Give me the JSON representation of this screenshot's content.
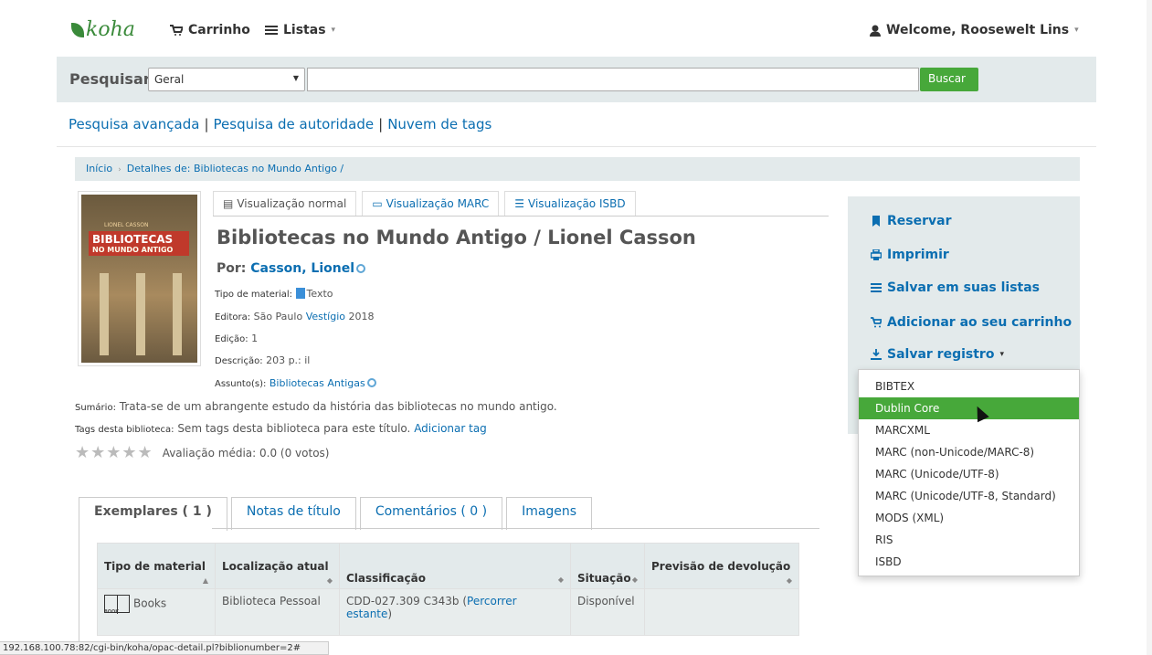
{
  "nav": {
    "logo": "koha",
    "cart": "Carrinho",
    "lists": "Listas",
    "welcome": "Welcome, Roosewelt Lins"
  },
  "search": {
    "label": "Pesquisar",
    "type_selected": "Geral",
    "query": "",
    "button": "Buscar"
  },
  "links": {
    "advanced": "Pesquisa avançada",
    "authority": "Pesquisa de autoridade",
    "tagcloud": "Nuvem de tags",
    "sep": "|"
  },
  "breadcrumb": {
    "home": "Início",
    "current": "Detalhes de: Bibliotecas no Mundo Antigo /"
  },
  "cover": {
    "author": "LIONEL CASSON",
    "title": "BIBLIOTECAS",
    "subtitle": "NO MUNDO ANTIGO"
  },
  "view_tabs": {
    "normal": "Visualização normal",
    "marc": "Visualização MARC",
    "isbd": "Visualização ISBD"
  },
  "record": {
    "title": "Bibliotecas no Mundo Antigo / Lionel Casson",
    "author_label": "Por:",
    "author": "Casson, Lionel",
    "material_label": "Tipo de material:",
    "material": "Texto",
    "publisher_label": "Editora:",
    "publisher_place": "São Paulo",
    "publisher": "Vestígio",
    "year": "2018",
    "edition_label": "Edição:",
    "edition": "1",
    "description_label": "Descrição:",
    "description": "203 p.: il",
    "subject_label": "Assunto(s):",
    "subject": "Bibliotecas Antigas",
    "summary_label": "Sumário:",
    "summary": "Trata-se de um abrangente estudo da história das bibliotecas no mundo antigo.",
    "tags_label": "Tags desta biblioteca:",
    "tags_text": "Sem tags desta biblioteca para este título.",
    "add_tag": "Adicionar tag",
    "stars": "★★★★★",
    "rating_text": "Avaliação média: 0.0 (0 votos)",
    "rating_value": 0.0
  },
  "lower_tabs": {
    "items": "Exemplares ( 1 )",
    "notes": "Notas de título",
    "comments": "Comentários ( 0 )",
    "images": "Imagens"
  },
  "table": {
    "headers": [
      "Tipo de material",
      "Localização atual",
      "Classificação",
      "Situação",
      "Previsão de devolução"
    ],
    "row": {
      "type": "Books",
      "book_icon_label": "BOOK",
      "location": "Biblioteca Pessoal",
      "classification": "CDD-027.309 C343b (",
      "browse": "Percorrer estante",
      "classification_end": ")",
      "status": "Disponível",
      "due": ""
    }
  },
  "sidebar": {
    "reserve": "Reservar",
    "print": "Imprimir",
    "save_lists": "Salvar em suas listas",
    "add_cart": "Adicionar ao seu carrinho",
    "save_record": "Salvar registro"
  },
  "dropdown": {
    "items": [
      "BIBTEX",
      "Dublin Core",
      "MARCXML",
      "MARC (non-Unicode/MARC-8)",
      "MARC (Unicode/UTF-8)",
      "MARC (Unicode/UTF-8, Standard)",
      "MODS (XML)",
      "RIS",
      "ISBD"
    ],
    "active": "Dublin Core"
  },
  "statusbar": "192.168.100.78:82/cgi-bin/koha/opac-detail.pl?biblionumber=2#",
  "colors": {
    "accent_green": "#47a83a",
    "link_blue": "#0b6eb1",
    "panel_gray": "#e3eaeb"
  }
}
